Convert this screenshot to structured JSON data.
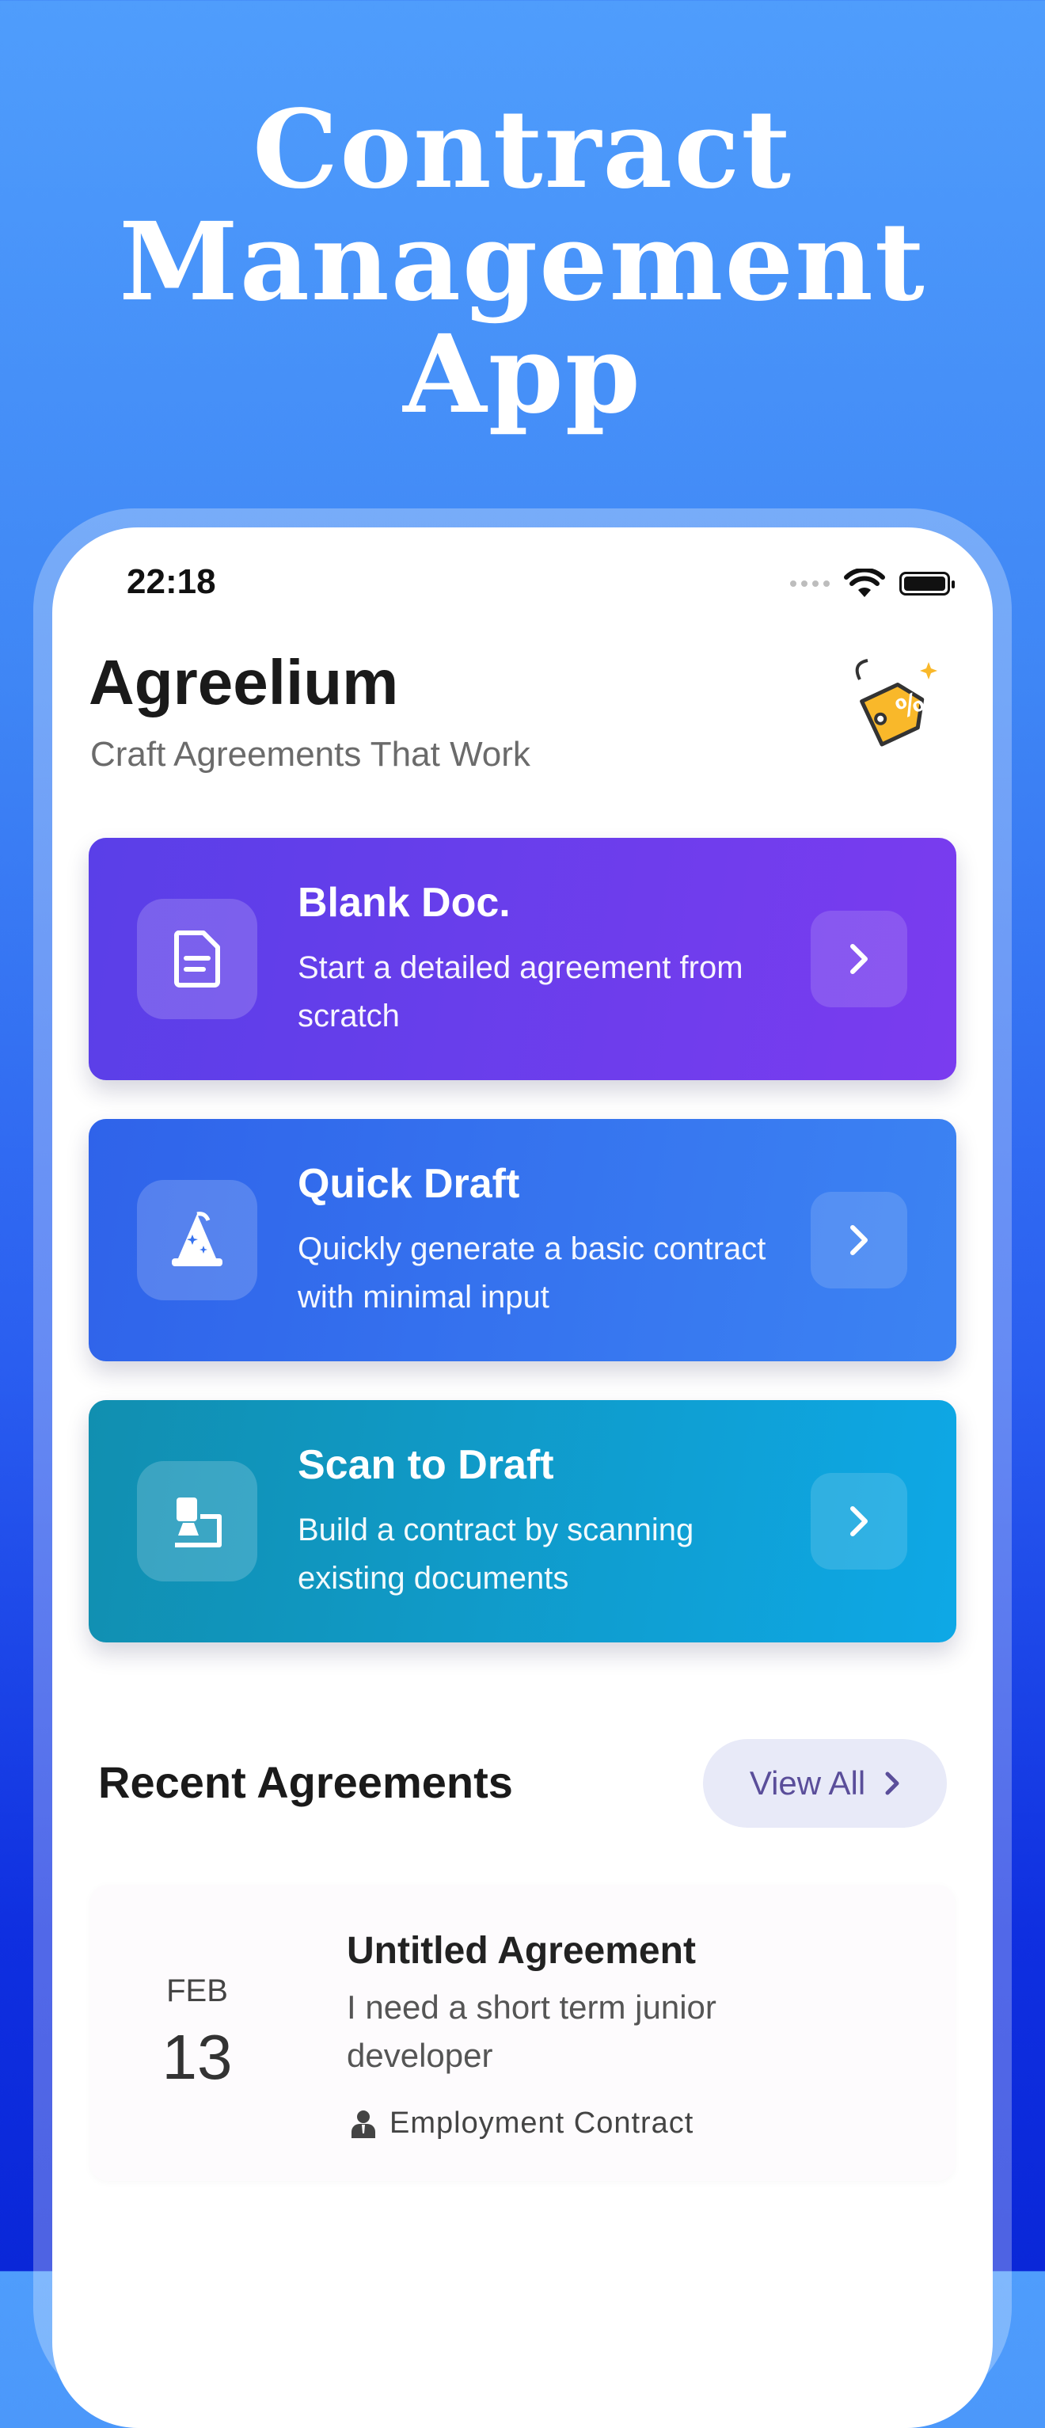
{
  "promo": {
    "title_lines": [
      "Contract",
      "Management",
      "App"
    ]
  },
  "status_bar": {
    "time": "22:18"
  },
  "header": {
    "app_name": "Agreelium",
    "tagline": "Craft Agreements That Work"
  },
  "actions": [
    {
      "title": "Blank Doc.",
      "description": "Start a detailed agreement from scratch",
      "icon": "document-icon"
    },
    {
      "title": "Quick Draft",
      "description": "Quickly generate a basic contract with minimal input",
      "icon": "wizard-hat-icon"
    },
    {
      "title": "Scan to Draft",
      "description": "Build a contract by scanning existing documents",
      "icon": "scanner-icon"
    }
  ],
  "recent": {
    "title": "Recent Agreements",
    "view_all_label": "View All",
    "items": [
      {
        "month": "FEB",
        "day": "13",
        "title": "Untitled Agreement",
        "description": "I need a short term junior developer",
        "type": "Employment Contract"
      }
    ]
  },
  "colors": {
    "purple": "#6a3eec",
    "blue": "#3672ef",
    "teal": "#0f9bcb",
    "badge_yellow": "#f9b82a"
  }
}
